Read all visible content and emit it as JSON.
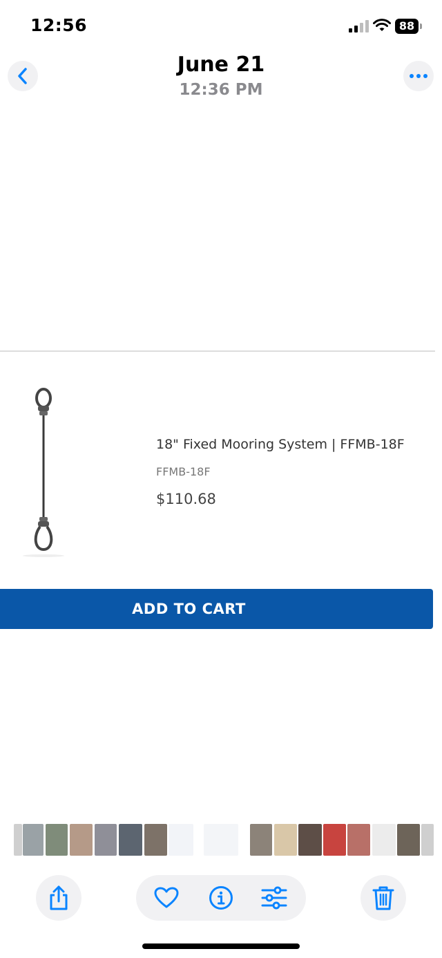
{
  "status_bar": {
    "time": "12:56",
    "battery": "88",
    "icons": [
      "cellular-signal-icon",
      "wifi-icon",
      "battery-icon"
    ]
  },
  "header": {
    "title": "June 21",
    "subtitle": "12:36 PM",
    "back_icon": "chevron-left-icon",
    "more_icon": "ellipsis-icon"
  },
  "product": {
    "name": "18\" Fixed Mooring System | FFMB-18F",
    "sku": "FFMB-18F",
    "price": "$110.68",
    "image": "mooring-cable-image"
  },
  "cart": {
    "button_label": "ADD TO CART"
  },
  "thumbnail_strip": {
    "count": 20
  },
  "toolbar": {
    "icons": [
      "share-icon",
      "heart-icon",
      "info-icon",
      "adjust-icon",
      "trash-icon"
    ]
  },
  "colors": {
    "accent": "#0a84ff",
    "cart_button": "#0a57a8",
    "subtitle_gray": "#8a8a8e"
  }
}
